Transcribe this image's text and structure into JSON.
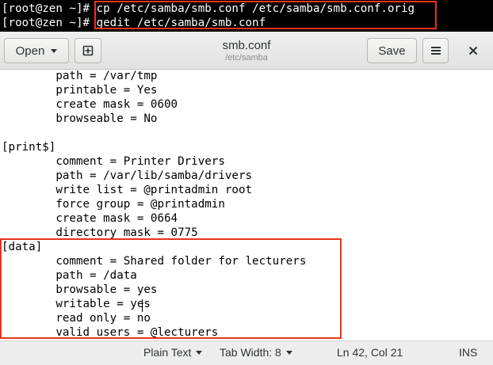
{
  "terminal": {
    "lines": [
      {
        "prompt": "[root@zen ~]#",
        "command": " cp /etc/samba/smb.conf /etc/samba/smb.conf.orig"
      },
      {
        "prompt": "[root@zen ~]#",
        "command": " gedit /etc/samba/smb.conf"
      }
    ],
    "highlight_color": "#e8341c"
  },
  "headerbar": {
    "open_label": "Open",
    "save_label": "Save",
    "title": "smb.conf",
    "subtitle": "/etc/samba"
  },
  "editor": {
    "lines": [
      "        path = /var/tmp",
      "        printable = Yes",
      "        create mask = 0600",
      "        browseable = No",
      "",
      "[print$]",
      "        comment = Printer Drivers",
      "        path = /var/lib/samba/drivers",
      "        write list = @printadmin root",
      "        force group = @printadmin",
      "        create mask = 0664",
      "        directory mask = 0775",
      "[data]",
      "        comment = Shared folder for lecturers",
      "        path = /data",
      "        browsable = yes",
      "        writable = yes",
      "        read only = no",
      "        valid users = @lecturers"
    ]
  },
  "statusbar": {
    "language": "Plain Text",
    "tab_width": "Tab Width: 8",
    "position": "Ln 42, Col 21",
    "mode": "INS"
  }
}
